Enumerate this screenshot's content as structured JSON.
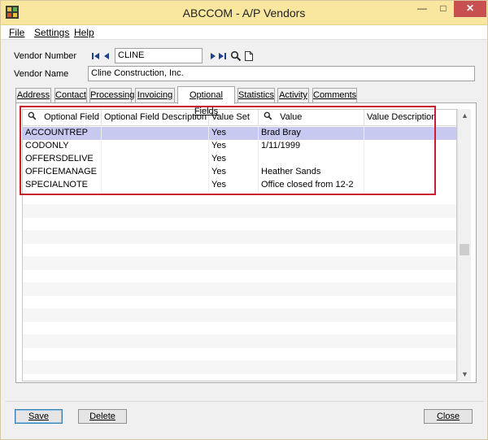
{
  "window": {
    "title": "ABCCOM - A/P Vendors",
    "min_label": "—",
    "max_label": "□",
    "close_label": "✕"
  },
  "menu": {
    "items": [
      {
        "label": "File"
      },
      {
        "label": "Settings"
      },
      {
        "label": "Help"
      }
    ]
  },
  "vendor": {
    "number_label": "Vendor Number",
    "number_value": "CLINE",
    "name_label": "Vendor Name",
    "name_value": "Cline Construction, Inc."
  },
  "tabs": [
    {
      "label": "Address"
    },
    {
      "label": "Contact"
    },
    {
      "label": "Processing"
    },
    {
      "label": "Invoicing"
    },
    {
      "label": "Optional Fields"
    },
    {
      "label": "Statistics"
    },
    {
      "label": "Activity"
    },
    {
      "label": "Comments"
    }
  ],
  "grid": {
    "headers": {
      "optional_field": "Optional Field",
      "description": "Optional Field Description",
      "value_set": "Value Set",
      "value": "Value",
      "value_description": "Value Description"
    },
    "rows": [
      {
        "field": "ACCOUNTREP",
        "description": "",
        "value_set": "Yes",
        "value": "Brad Bray",
        "value_description": ""
      },
      {
        "field": "CODONLY",
        "description": "",
        "value_set": "Yes",
        "value": "1/11/1999",
        "value_description": ""
      },
      {
        "field": "OFFERSDELIVE",
        "description": "",
        "value_set": "Yes",
        "value": "",
        "value_description": ""
      },
      {
        "field": "OFFICEMANAGE",
        "description": "",
        "value_set": "Yes",
        "value": "Heather Sands",
        "value_description": ""
      },
      {
        "field": "SPECIALNOTE",
        "description": "",
        "value_set": "Yes",
        "value": "Office closed from 12-2",
        "value_description": ""
      }
    ]
  },
  "buttons": {
    "save": "Save",
    "delete": "Delete",
    "close": "Close"
  },
  "colors": {
    "titlebar": "#f9e79f",
    "selected_row": "#c7c9f0",
    "highlight_border": "#cc1f2e"
  }
}
